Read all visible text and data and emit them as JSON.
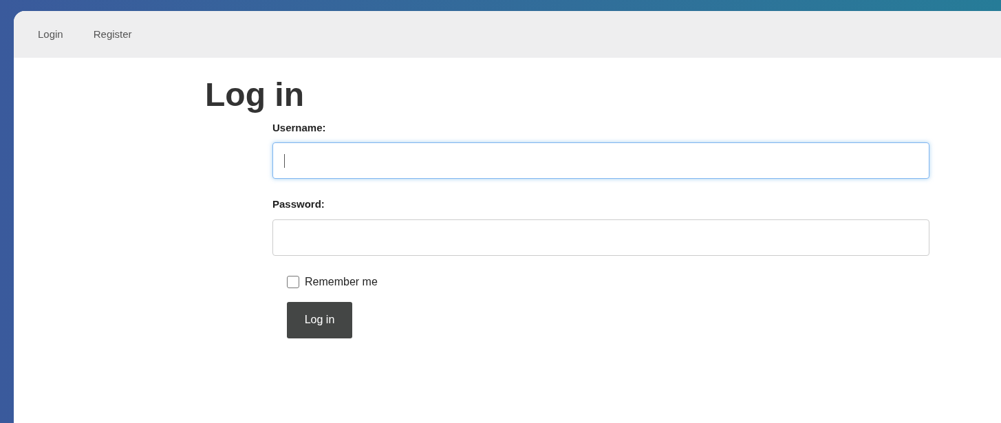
{
  "nav": {
    "items": [
      {
        "label": "Login"
      },
      {
        "label": "Register"
      }
    ]
  },
  "heading": "Log in",
  "form": {
    "fields": [
      {
        "label": "Username:",
        "focused": true
      },
      {
        "label": "Password:",
        "focused": false
      }
    ],
    "remember": {
      "label": "Remember me",
      "checked": false
    },
    "submit": "Log in"
  }
}
